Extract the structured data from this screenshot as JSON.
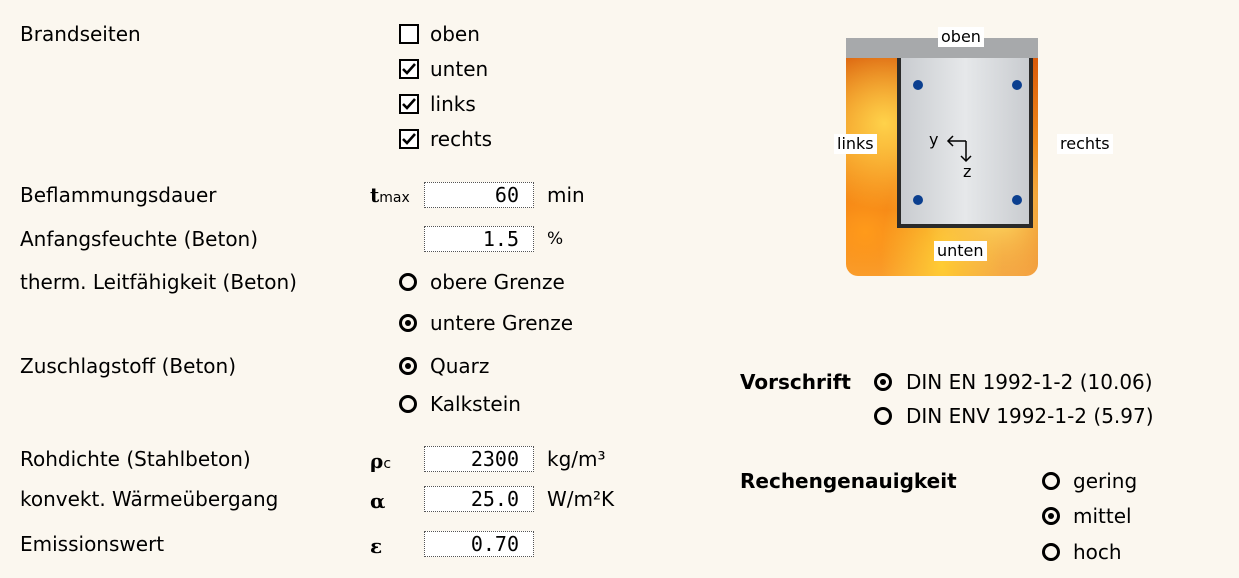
{
  "brandseiten": {
    "label": "Brandseiten",
    "options": [
      {
        "label": "oben",
        "checked": false
      },
      {
        "label": "unten",
        "checked": true
      },
      {
        "label": "links",
        "checked": true
      },
      {
        "label": "rechts",
        "checked": true
      }
    ]
  },
  "beflammungsdauer": {
    "label": "Beflammungsdauer",
    "symbol": "t",
    "subscript": "max",
    "value": "60",
    "unit": "min"
  },
  "anfangsfeuchte": {
    "label": "Anfangsfeuchte (Beton)",
    "value": "1.5",
    "unit": "%"
  },
  "leitfaehigkeit": {
    "label": "therm. Leitfähigkeit (Beton)",
    "options": [
      {
        "label": "obere Grenze",
        "selected": false
      },
      {
        "label": "untere Grenze",
        "selected": true
      }
    ]
  },
  "zuschlagstoff": {
    "label": "Zuschlagstoff (Beton)",
    "options": [
      {
        "label": "Quarz",
        "selected": true
      },
      {
        "label": "Kalkstein",
        "selected": false
      }
    ]
  },
  "rohdichte": {
    "label": "Rohdichte (Stahlbeton)",
    "symbol": "ρ",
    "subscript": "c",
    "value": "2300",
    "unit": "kg/m³"
  },
  "waermeuebergang": {
    "label": "konvekt. Wärmeübergang",
    "symbol": "α",
    "value": "25.0",
    "unit": "W/m²K"
  },
  "emission": {
    "label": "Emissionswert",
    "symbol": "ε",
    "value": "0.70"
  },
  "diagram": {
    "top": "oben",
    "bottom": "unten",
    "left": "links",
    "right": "rechts",
    "axis_y": "y",
    "axis_z": "z"
  },
  "vorschrift": {
    "label": "Vorschrift",
    "options": [
      {
        "label": "DIN EN 1992-1-2 (10.06)",
        "selected": true
      },
      {
        "label": "DIN ENV 1992-1-2 (5.97)",
        "selected": false
      }
    ]
  },
  "genauigkeit": {
    "label": "Rechengenauigkeit",
    "options": [
      {
        "label": "gering",
        "selected": false
      },
      {
        "label": "mittel",
        "selected": true
      },
      {
        "label": "hoch",
        "selected": false
      }
    ]
  },
  "colors": {
    "background": "#fbf7ef",
    "rebar": "#0b3f8f",
    "slab": "#a7a9ab"
  }
}
